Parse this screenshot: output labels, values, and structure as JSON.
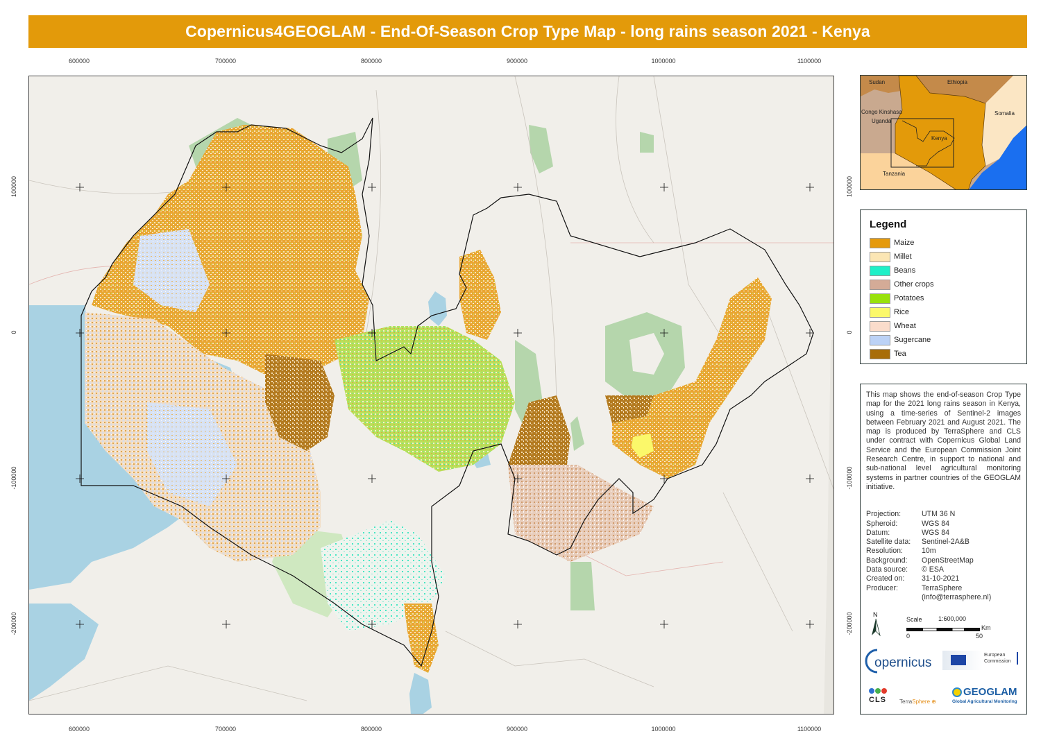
{
  "title": "Copernicus4GEOGLAM - End-Of-Season Crop Type Map - long rains season 2021 - Kenya",
  "axes": {
    "x_ticks": [
      "600000",
      "700000",
      "800000",
      "900000",
      "1000000",
      "1100000"
    ],
    "y_ticks": [
      "100000",
      "0",
      "-100000",
      "-200000"
    ]
  },
  "inset_map": {
    "labels": [
      "Sudan",
      "Ethiopia",
      "Congo Kinshasa",
      "Uganda",
      "Somalia",
      "Kenya",
      "Tanzania"
    ]
  },
  "legend": {
    "title": "Legend",
    "items": [
      {
        "label": "Maize",
        "color": "#e59a0c"
      },
      {
        "label": "Millet",
        "color": "#fbe6b4"
      },
      {
        "label": "Beans",
        "color": "#1ef0c8"
      },
      {
        "label": "Other crops",
        "color": "#d4ab97"
      },
      {
        "label": "Potatoes",
        "color": "#98e10c"
      },
      {
        "label": "Rice",
        "color": "#fbf86a"
      },
      {
        "label": "Wheat",
        "color": "#fadccb"
      },
      {
        "label": "Sugercane",
        "color": "#bcd2f6"
      },
      {
        "label": "Tea",
        "color": "#a86d08"
      }
    ]
  },
  "description": "This map shows the end-of-season Crop Type map for the 2021 long rains season in Kenya, using a time-series of Sentinel-2 images between February 2021 and August 2021. The map is produced by TerraSphere and CLS under contract with Copernicus Global Land Service and the European Commission Joint Research Centre, in support to national and sub-national level agricultural monitoring systems in partner countries of the GEOGLAM initiative.",
  "metadata": [
    {
      "key": "Projection:",
      "value": "UTM 36 N"
    },
    {
      "key": "Spheroid:",
      "value": "WGS 84"
    },
    {
      "key": "Datum:",
      "value": "WGS 84"
    },
    {
      "key": "Satellite data:",
      "value": "Sentinel-2A&B"
    },
    {
      "key": "Resolution:",
      "value": "10m"
    },
    {
      "key": "Background:",
      "value": "OpenStreetMap"
    },
    {
      "key": "Data source:",
      "value": "© ESA"
    },
    {
      "key": "Created on:",
      "value": "31-10-2021"
    },
    {
      "key": "Producer:",
      "value": "TerraSphere"
    },
    {
      "key": "",
      "value": "(info@terrasphere.nl)"
    }
  ],
  "north_arrow": "N",
  "scale": {
    "label": "Scale",
    "ratio": "1:600,000",
    "unit": "Km",
    "start": "0",
    "end": "50"
  },
  "logos": {
    "copernicus": "opernicus",
    "ec_line1": "European",
    "ec_line2": "Commission",
    "cls": "CLS",
    "terrasphere_a": "Terra",
    "terrasphere_b": "Sphere",
    "geoglam": "GEOGLAM",
    "geoglam_sub": "Global Agricultural Monitoring"
  },
  "colors": {
    "title_bg": "#e39a0a",
    "background_land": "#f1efea",
    "water": "#a9d2e3",
    "park": "#b5d6ac",
    "kenya_inset": "#e39a0a"
  }
}
